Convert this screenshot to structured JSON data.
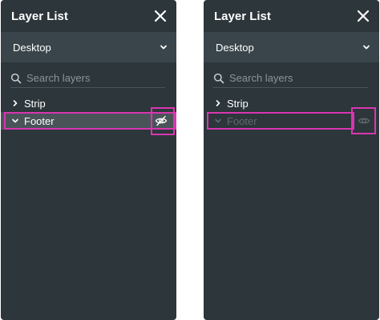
{
  "panels": [
    {
      "title": "Layer List",
      "device": "Desktop",
      "search_placeholder": "Search layers",
      "layers": [
        {
          "label": "Strip",
          "expanded": false
        },
        {
          "label": "Footer",
          "expanded": true,
          "visible": true
        }
      ]
    },
    {
      "title": "Layer List",
      "device": "Desktop",
      "search_placeholder": "Search layers",
      "layers": [
        {
          "label": "Strip",
          "expanded": false
        },
        {
          "label": "Footer",
          "expanded": true,
          "visible": false
        }
      ]
    }
  ],
  "colors": {
    "panel_bg": "#2c363b",
    "dropdown_bg": "#3a454b",
    "selected_row_bg": "#495459",
    "highlight": "#d936b0",
    "hidden_text": "#5f6a70"
  },
  "icons": {
    "close": "close-icon",
    "dropdown": "chevron-down-icon",
    "search": "search-icon",
    "collapsed": "chevron-right-icon",
    "expanded": "chevron-down-icon",
    "visibility_off": "eye-slash-icon",
    "visibility_on": "eye-icon"
  }
}
